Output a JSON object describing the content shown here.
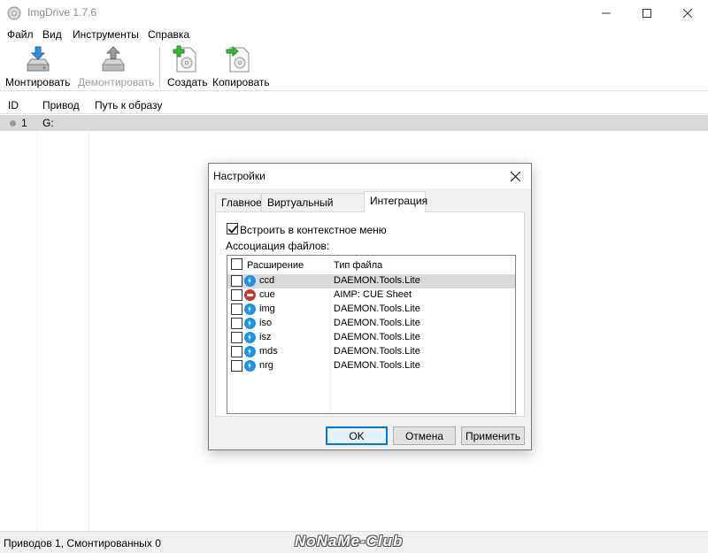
{
  "window": {
    "title": "ImgDrive 1.7.6"
  },
  "menu": [
    "Файл",
    "Вид",
    "Инструменты",
    "Справка"
  ],
  "toolbar": {
    "mount": "Монтировать",
    "unmount": "Демонтировать",
    "create": "Создать",
    "copy": "Копировать"
  },
  "list": {
    "columns": [
      "ID",
      "Привод",
      "Путь к образу"
    ],
    "rows": [
      {
        "id": "1",
        "drive": "G:",
        "path": ""
      }
    ]
  },
  "status": {
    "text": "Приводов 1, Смонтированных 0"
  },
  "watermark": "NoNaMe-Club",
  "dialog": {
    "title": "Настройки",
    "tabs": [
      "Главное",
      "Виртуальный привод",
      "Интеграция"
    ],
    "active_tab": "Интеграция",
    "context_menu_option": "Встроить в контекстное меню",
    "context_menu_checked": true,
    "assoc_label": "Ассоциация файлов:",
    "grid": {
      "columns": [
        "Расширение",
        "Тип файла"
      ],
      "rows": [
        {
          "ext": "ccd",
          "type": "DAEMON.Tools.Lite",
          "icon": "daemon-tools-icon",
          "checked": false,
          "selected": true
        },
        {
          "ext": "cue",
          "type": "AIMP: CUE Sheet",
          "icon": "aimp-icon",
          "checked": false,
          "selected": false
        },
        {
          "ext": "img",
          "type": "DAEMON.Tools.Lite",
          "icon": "daemon-tools-icon",
          "checked": false,
          "selected": false
        },
        {
          "ext": "iso",
          "type": "DAEMON.Tools.Lite",
          "icon": "daemon-tools-icon",
          "checked": false,
          "selected": false
        },
        {
          "ext": "isz",
          "type": "DAEMON.Tools.Lite",
          "icon": "daemon-tools-icon",
          "checked": false,
          "selected": false
        },
        {
          "ext": "mds",
          "type": "DAEMON.Tools.Lite",
          "icon": "daemon-tools-icon",
          "checked": false,
          "selected": false
        },
        {
          "ext": "nrg",
          "type": "DAEMON.Tools.Lite",
          "icon": "daemon-tools-icon",
          "checked": false,
          "selected": false
        }
      ]
    },
    "buttons": {
      "ok": "OK",
      "cancel": "Отмена",
      "apply": "Применить"
    }
  },
  "colors": {
    "accent": "#0078d7",
    "selection": "#d9d9d9",
    "daemon_icon": "#1e90e8",
    "aimp_icon": "#c0392b"
  }
}
